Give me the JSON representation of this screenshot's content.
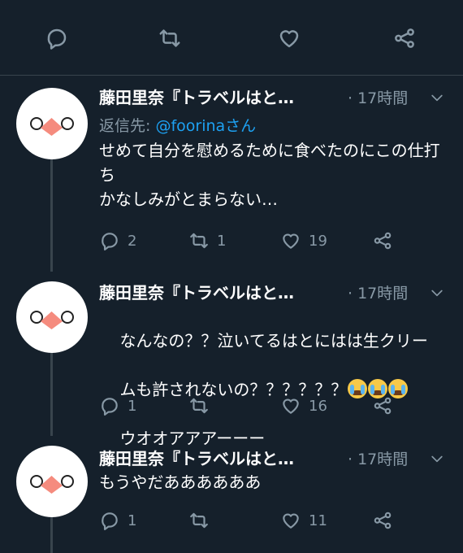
{
  "top_actions": {
    "icons": [
      "comment-icon",
      "retweet-icon",
      "like-icon",
      "share-icon"
    ]
  },
  "colors": {
    "background": "#15202b",
    "muted": "#8899a6",
    "accent": "#1da1f2",
    "divider": "#38444d"
  },
  "tweets": [
    {
      "name": "藤田里奈『トラベルはと…",
      "time": "· 17時間",
      "reply_label": "返信先: ",
      "reply_mention": "@foorinaさん",
      "text": "せめて自分を慰めるために食べたのにこの仕打ち\nかなしみがとまらない…",
      "replies": "2",
      "retweets": "1",
      "likes": "19"
    },
    {
      "name": "藤田里奈『トラベルはと…",
      "time": "· 17時間",
      "text_line1": "なんなの？？泣いてるはとにはは生クリー",
      "text_line2": "ムも許されないの？？？？？？",
      "text_line3": "ウオオアアアーーー",
      "emoji": "loudly-crying-face-emoji",
      "replies": "1",
      "retweets": "",
      "likes": "16"
    },
    {
      "name": "藤田里奈『トラベルはと…",
      "time": "· 17時間",
      "text": "もうやだああああああ",
      "replies": "1",
      "retweets": "",
      "likes": "11"
    }
  ]
}
